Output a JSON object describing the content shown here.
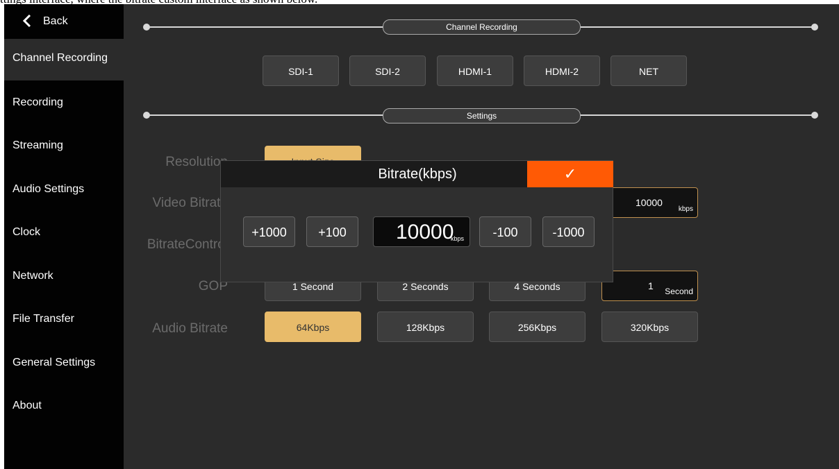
{
  "caption": "ttings interface, where the bitrate custom interface as shown below.",
  "sidebar": {
    "back_label": "Back",
    "items": [
      {
        "label": "Channel Recording"
      },
      {
        "label": "Recording"
      },
      {
        "label": "Streaming"
      },
      {
        "label": "Audio Settings"
      },
      {
        "label": "Clock"
      },
      {
        "label": "Network"
      },
      {
        "label": "File Transfer"
      },
      {
        "label": "General Settings"
      },
      {
        "label": "About"
      }
    ]
  },
  "main": {
    "section_channel": "Channel Recording",
    "channels": [
      "SDI-1",
      "SDI-2",
      "HDMI-1",
      "HDMI-2",
      "NET"
    ],
    "section_settings": "Settings",
    "resolution": {
      "label": "Resolution",
      "selected": "Input Size"
    },
    "video_bitrate": {
      "label": "Video Bitrate",
      "value": "10000",
      "unit": "kbps"
    },
    "bitrate_control": {
      "label": "BitrateControl"
    },
    "gop": {
      "label": "GOP",
      "options": [
        "1 Second",
        "2 Seconds",
        "4 Seconds"
      ],
      "custom_value": "1",
      "custom_unit": "Second"
    },
    "audio_bitrate": {
      "label": "Audio Bitrate",
      "options": [
        "64Kbps",
        "128Kbps",
        "256Kbps",
        "320Kbps"
      ],
      "selected": "64Kbps"
    }
  },
  "modal": {
    "title": "Bitrate(kbps)",
    "confirm_glyph": "✓",
    "steps": [
      "+1000",
      "+100",
      "-100",
      "-1000"
    ],
    "value": "10000",
    "unit": "kbps"
  },
  "colors": {
    "accent": "#ff5a05",
    "selected": "#e8bb6a",
    "sidebar": "#020202",
    "background": "#2b2b2b"
  }
}
